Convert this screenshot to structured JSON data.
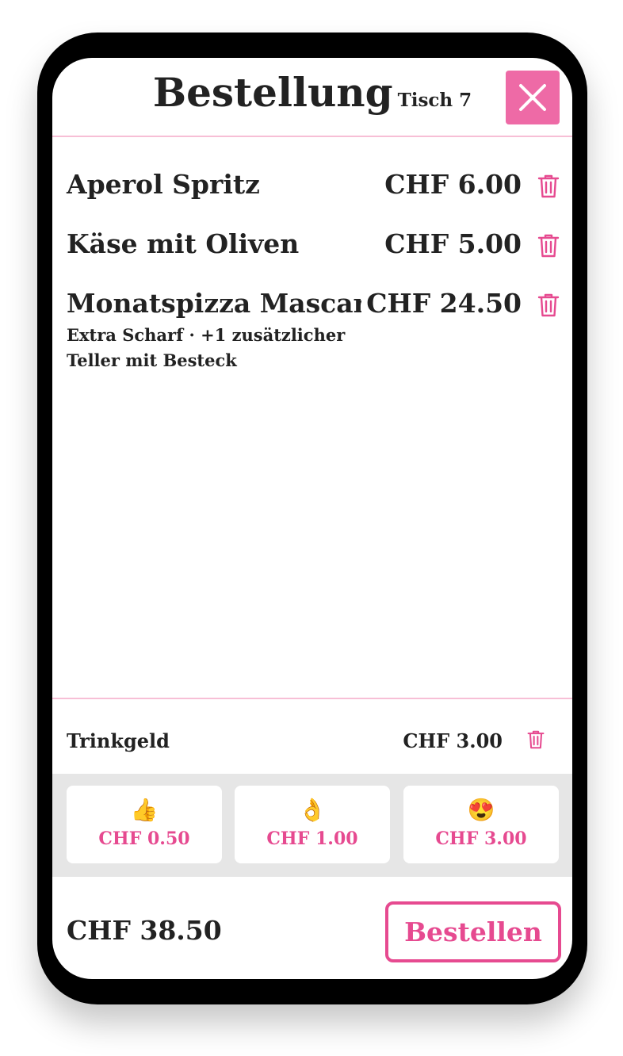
{
  "header": {
    "title": "Bestellung",
    "table_label": "Tisch 7",
    "close_icon": "close-icon"
  },
  "order_items": [
    {
      "name": "Aperol Spritz",
      "price": "CHF 6.00",
      "notes": ""
    },
    {
      "name": "Käse mit Oliven",
      "price": "CHF 5.00",
      "notes": ""
    },
    {
      "name": "Monatspizza Mascarpone",
      "price": "CHF 24.50",
      "notes": "Extra Scharf · +1 zusätzlicher Teller mit Besteck"
    }
  ],
  "tip": {
    "label": "Trinkgeld",
    "value": "CHF 3.00",
    "options": [
      {
        "emoji": "👍",
        "amount": "CHF 0.50"
      },
      {
        "emoji": "👌",
        "amount": "CHF 1.00"
      },
      {
        "emoji": "😍",
        "amount": "CHF 3.00"
      }
    ]
  },
  "footer": {
    "total": "CHF 38.50",
    "order_button": "Bestellen"
  },
  "colors": {
    "accent": "#e64a90",
    "close_button_bg": "#ee6aa6",
    "divider": "#f7bfd6",
    "tip_panel_bg": "#e6e6e6"
  }
}
